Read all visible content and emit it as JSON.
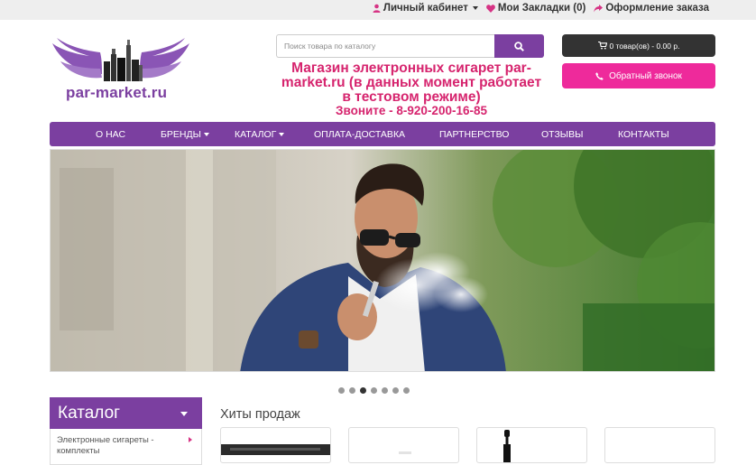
{
  "topbar": {
    "account": "Личный кабинет",
    "bookmarks": "Мои Закладки (0)",
    "checkout": "Оформление заказа"
  },
  "header": {
    "logo_text": "par-market.ru",
    "search_placeholder": "Поиск товара по каталогу",
    "headline": "Магазин электронных сигарет par-market.ru (в данных момент работает в тестовом режиме)",
    "phone": "Звоните - 8-920-200-16-85",
    "cart": "0 товар(ов) - 0.00 р.",
    "callback": "Обратный звонок"
  },
  "nav": {
    "items": [
      {
        "label": "О НАС"
      },
      {
        "label": "БРЕНДЫ"
      },
      {
        "label": "КАТАЛОГ"
      },
      {
        "label": "ОПЛАТА-ДОСТАВКА"
      },
      {
        "label": "ПАРТНЕРСТВО"
      },
      {
        "label": "ОТЗЫВЫ"
      },
      {
        "label": "КОНТАКТЫ"
      }
    ]
  },
  "slider": {
    "slide_count": 7,
    "active_index": 2
  },
  "sidebar": {
    "title": "Каталог",
    "items": [
      {
        "label": "Электронные сигареты - комплекты"
      }
    ]
  },
  "main": {
    "section_title": "Хиты продаж"
  },
  "colors": {
    "brand": "#7b3fa0",
    "accent": "#ee2a9b",
    "headline": "#d6246e",
    "dark": "#333333"
  }
}
